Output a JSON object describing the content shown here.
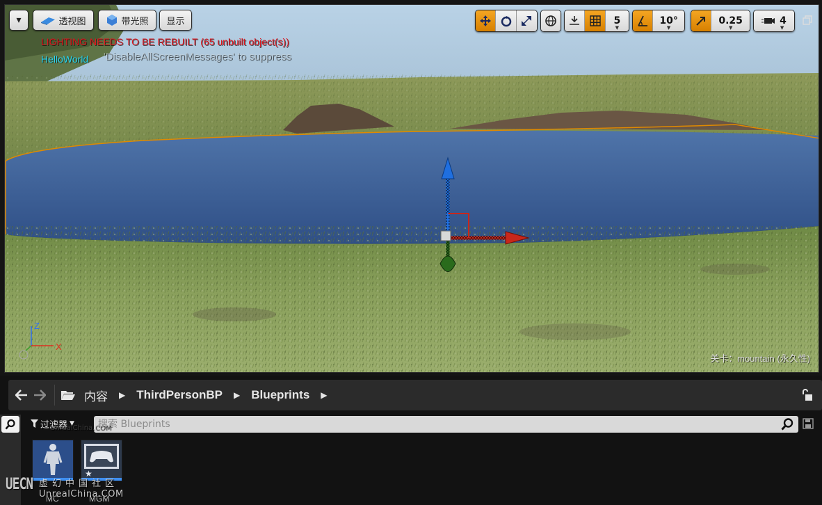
{
  "viewport": {
    "menu_caret": "▾",
    "view_mode_label": "透视图",
    "lighting_mode_label": "带光照",
    "show_label": "显示",
    "grid_snap_value": "5",
    "rotation_snap_value": "10°",
    "scale_snap_value": "0.25",
    "camera_speed_value": "4",
    "messages": {
      "lighting": "LIGHTING NEEDS TO BE REBUILT (65 unbuilt object(s))",
      "suppress": "'DisableAllScreenMessages' to suppress",
      "hello": "HelloWorld"
    },
    "level_label": "关卡：mountain (永久性)",
    "axis_labels": {
      "z": "Z",
      "x": "X"
    }
  },
  "content_browser": {
    "breadcrumb": [
      "内容",
      "ThirdPersonBP",
      "Blueprints"
    ],
    "filter_label": "过滤器",
    "search_placeholder": "搜索 Blueprints",
    "assets": [
      {
        "label": "MC"
      },
      {
        "label": "MGM"
      }
    ]
  },
  "watermark": {
    "logo": "UECN",
    "chinese": "虚幻中国社区",
    "url": "UnrealChina.COM",
    "faint": "UnrealChina.COM"
  },
  "colors": {
    "accent_orange": "#e08a00",
    "warning_red": "#e0141c",
    "hello_cyan": "#29d5ee",
    "selection_blue": "#3e8ef0"
  }
}
